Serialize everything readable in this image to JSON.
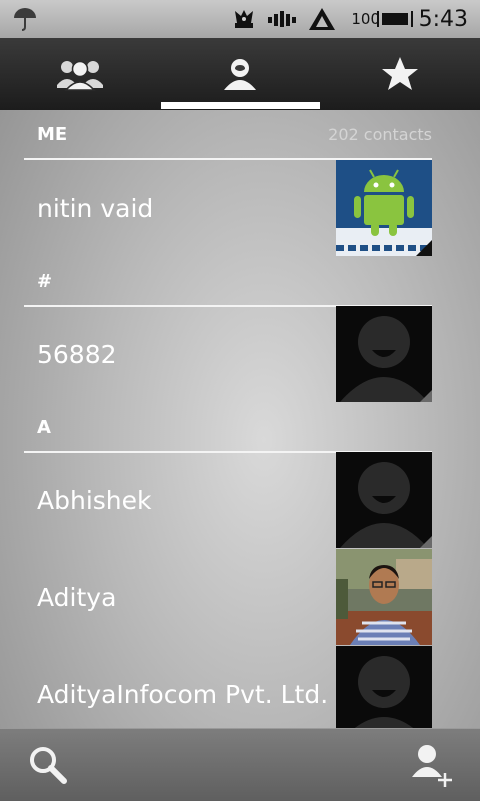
{
  "status_bar": {
    "battery_percent": "100",
    "time": "5:43",
    "icons": [
      "umbrella-icon",
      "app-notification-icon",
      "signal-bars-icon",
      "network-type-icon",
      "battery-icon"
    ]
  },
  "tabs": [
    {
      "icon": "groups-icon",
      "label": "Groups"
    },
    {
      "icon": "contacts-icon",
      "label": "Contacts",
      "selected": true
    },
    {
      "icon": "star-icon",
      "label": "Favorites"
    }
  ],
  "header": {
    "me_label": "ME",
    "contact_count": "202 contacts"
  },
  "sections": [
    {
      "letter": "#"
    },
    {
      "letter": "A"
    }
  ],
  "contacts": {
    "me": {
      "name": "nitin vaid",
      "photo": "android-logo-photo"
    },
    "hash": [
      {
        "name": "56882",
        "photo": "default-avatar"
      }
    ],
    "a": [
      {
        "name": "Abhishek",
        "photo": "default-avatar"
      },
      {
        "name": "Aditya",
        "photo": "person-photo"
      },
      {
        "name": "AdityaInfocom Pvt. Ltd.",
        "photo": "default-avatar"
      }
    ]
  },
  "bottom_bar": {
    "search_icon": "search-icon",
    "add_contact_icon": "add-contact-icon"
  },
  "colors": {
    "list_bg_center": "#d9d9d9",
    "list_bg_edge": "#8d8d8d",
    "tab_bar": "#2a2a2a",
    "android_green": "#8ac43f",
    "android_bg": "#1e4f86"
  }
}
